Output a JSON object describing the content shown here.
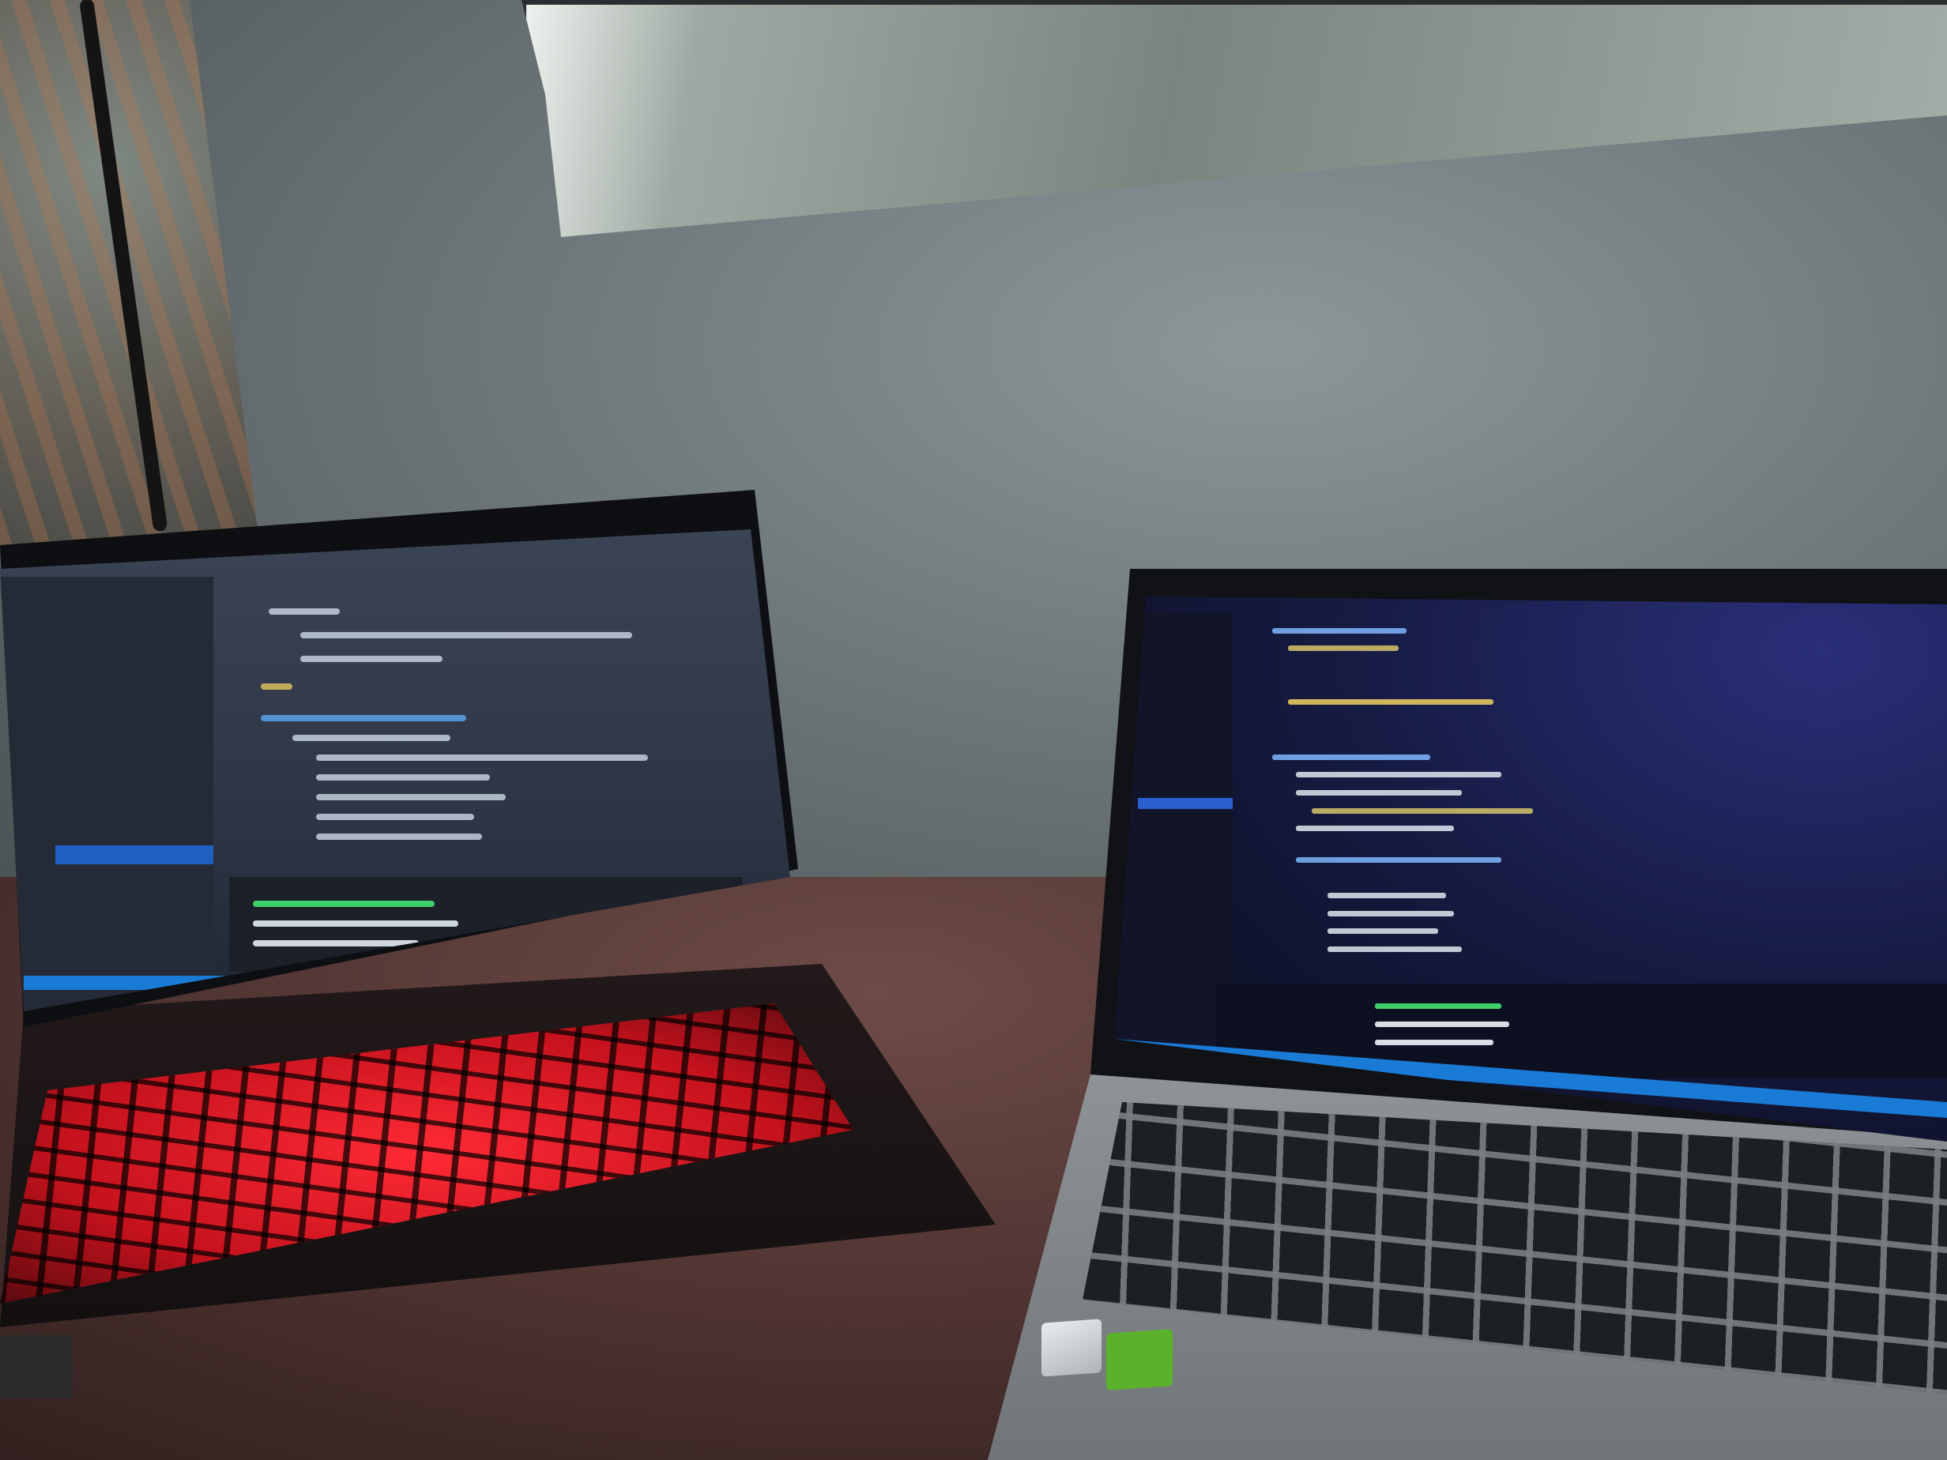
{
  "scene": {
    "colors": {
      "wall": "#7b8486",
      "table": "#5a3b38",
      "keyboard_glow": "#ff2a35",
      "left_screen": "#343d4f",
      "right_screen": "#151a40",
      "nvidia_sticker": "#5bb22a"
    },
    "laptop_left": {
      "keyboard_backlight": "red",
      "editor_theme": "dark"
    },
    "laptop_right": {
      "keyboard_backlight": "off",
      "editor_theme": "dark blue"
    }
  }
}
